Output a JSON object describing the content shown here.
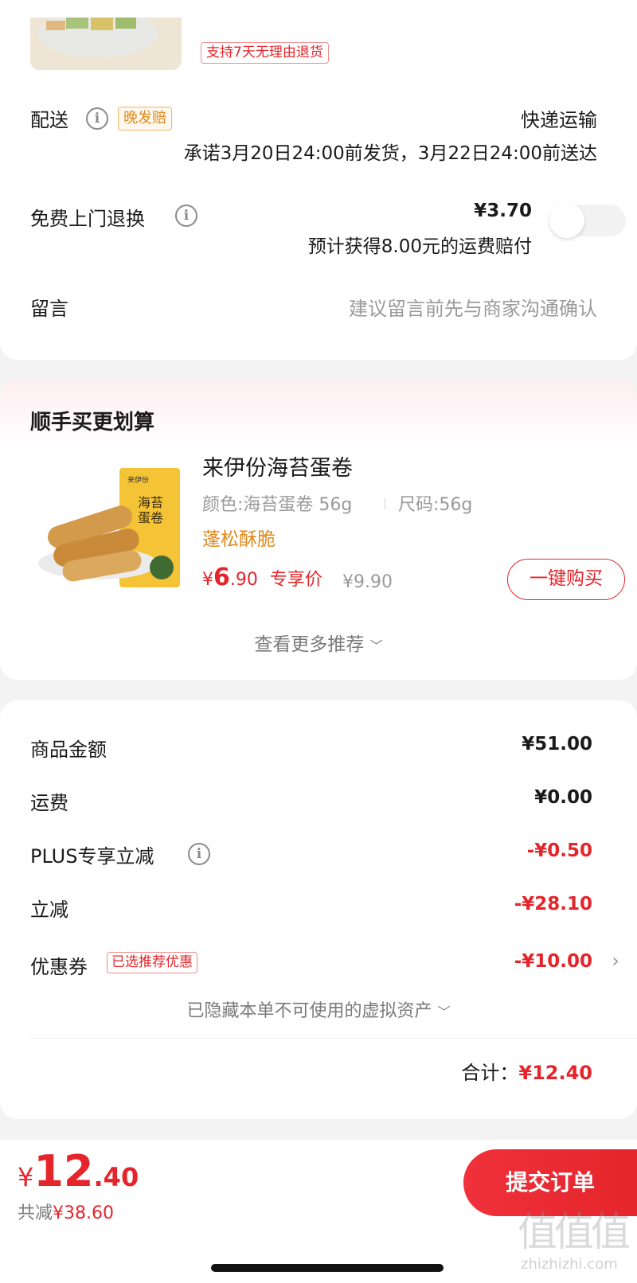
{
  "product": {
    "return_badge": "支持7天无理由退货"
  },
  "delivery": {
    "label": "配送",
    "late_badge": "晚发赔",
    "method": "快递运输",
    "promise": "承诺3月20日24:00前发货，3月22日24:00前送达"
  },
  "return_service": {
    "label": "免费上门退换",
    "price": "¥3.70",
    "note": "预计获得8.00元的运费赔付",
    "enabled": false
  },
  "message": {
    "label": "留言",
    "placeholder": "建议留言前先与商家沟通确认"
  },
  "recommend": {
    "title": "顺手买更划算",
    "item": {
      "name": "来伊份海苔蛋卷",
      "spec_color": "颜色:海苔蛋卷 56g",
      "spec_size": "尺码:56g",
      "tag": "蓬松酥脆",
      "price_symbol": "¥",
      "price_int": "6",
      "price_dec": ".90",
      "price_label": "专享价",
      "orig_price": "¥9.90",
      "buy_button": "一键购买",
      "pack_text": "海苔蛋卷",
      "brand_text": "来伊份"
    },
    "more_link": "查看更多推荐"
  },
  "summary": {
    "goods_label": "商品金额",
    "goods_value": "¥51.00",
    "shipping_label": "运费",
    "shipping_value": "¥0.00",
    "plus_label": "PLUS专享立减",
    "plus_value": "-¥0.50",
    "discount_label": "立减",
    "discount_value": "-¥28.10",
    "coupon_label": "优惠券",
    "coupon_badge": "已选推荐优惠",
    "coupon_value": "-¥10.00",
    "hidden_assets": "已隐藏本单不可使用的虚拟资产",
    "total_label": "合计：",
    "total_value": "¥12.40"
  },
  "footer": {
    "price_symbol": "¥",
    "price_int": "12",
    "price_dec": ".40",
    "saved_label": "共减",
    "saved_value": "¥38.60",
    "submit_button": "提交订单"
  },
  "watermark": {
    "logo": "值值值",
    "url": "zhizhizhi.com"
  },
  "colors": {
    "accent_red": "#e4252b",
    "orange_badge": "#e08a1e",
    "submit_gradient": [
      "#f0313b",
      "#e4252b"
    ]
  }
}
